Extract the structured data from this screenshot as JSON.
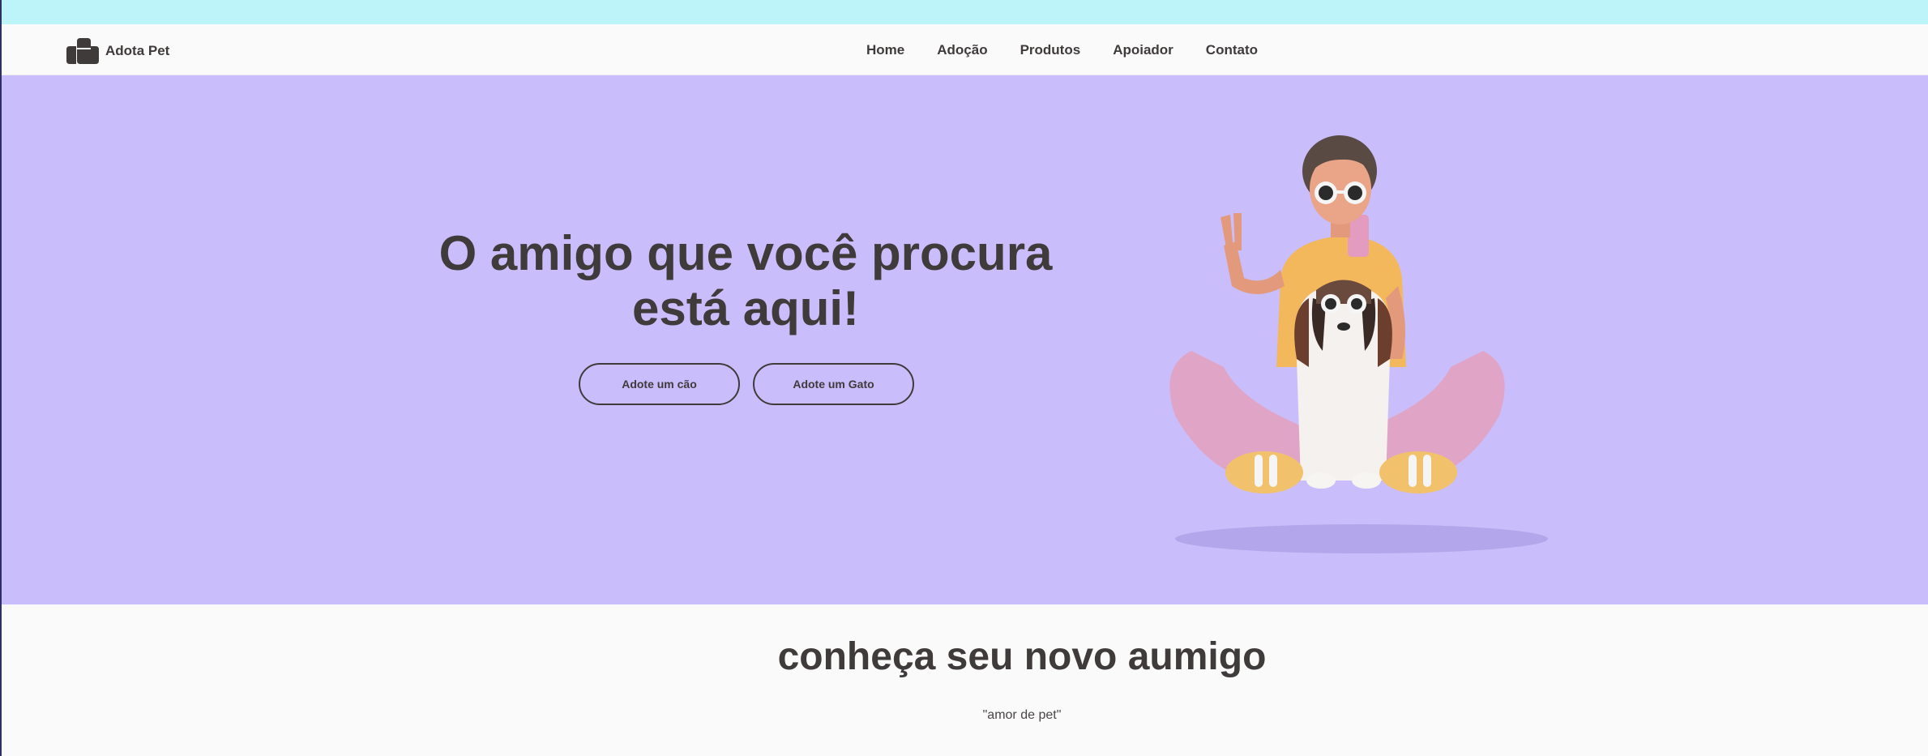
{
  "brand": {
    "name": "Adota Pet",
    "icon": "paw-logo-icon"
  },
  "nav": {
    "items": [
      {
        "label": "Home"
      },
      {
        "label": "Adoção"
      },
      {
        "label": "Produtos"
      },
      {
        "label": "Apoiador"
      },
      {
        "label": "Contato"
      }
    ]
  },
  "hero": {
    "title_line1": "O amigo que você procura",
    "title_line2": "está aqui!",
    "buttons": [
      {
        "label": "Adote um cão"
      },
      {
        "label": "Adote um Gato"
      }
    ],
    "illustration": "person-with-dog-illustration"
  },
  "section": {
    "title": "conheça seu novo aumigo",
    "quote": "\"amor de pet\""
  },
  "colors": {
    "top_strip": "#bdf4fa",
    "hero_bg": "#c9befb",
    "text": "#3f3b3b",
    "page_bg": "#fafafa"
  }
}
